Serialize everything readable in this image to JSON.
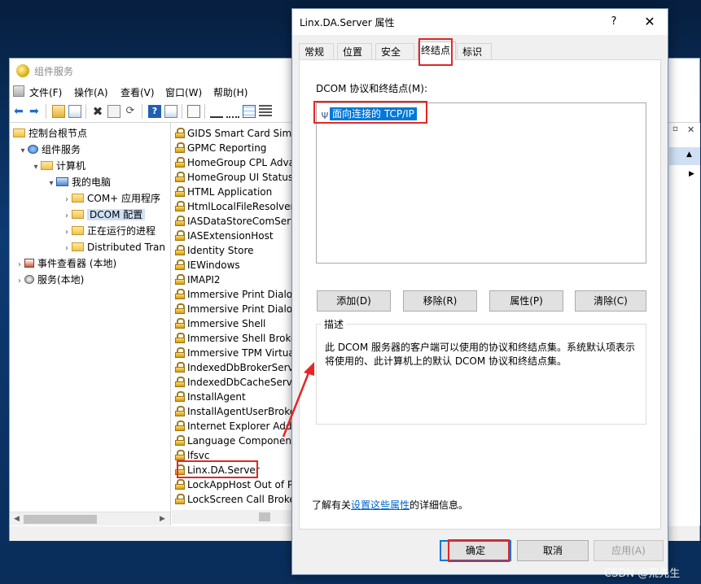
{
  "mmc": {
    "title": "组件服务",
    "menu": [
      "文件(F)",
      "操作(A)",
      "查看(V)",
      "窗口(W)",
      "帮助(H)"
    ],
    "tree": [
      {
        "label": "控制台根节点",
        "expander": ""
      },
      {
        "label": "组件服务",
        "expander": "▾"
      },
      {
        "label": "计算机",
        "expander": "▾"
      },
      {
        "label": "我的电脑",
        "expander": "▾"
      },
      {
        "label": "COM+ 应用程序",
        "expander": "›"
      },
      {
        "label": "DCOM 配置",
        "expander": "›"
      },
      {
        "label": "正在运行的进程",
        "expander": "›"
      },
      {
        "label": "Distributed Tran",
        "expander": "›"
      },
      {
        "label": "事件查看器 (本地)",
        "expander": "›"
      },
      {
        "label": "服务(本地)",
        "expander": "›"
      }
    ],
    "list": [
      "GIDS Smart Card Simu",
      "GPMC Reporting",
      "HomeGroup CPL Adva",
      "HomeGroup UI Status",
      "HTML Application",
      "HtmlLocalFileResolver",
      "IASDataStoreComServ",
      "IASExtensionHost",
      "Identity Store",
      "IEWindows",
      "IMAPI2",
      "Immersive Print Dialog",
      "Immersive Print Dialog",
      "Immersive Shell",
      "Immersive Shell Broke",
      "Immersive TPM Virtua",
      "IndexedDbBrokerServ",
      "IndexedDbCacheServe",
      "InstallAgent",
      "InstallAgentUserBroke",
      "Internet Explorer Add",
      "Language Component",
      "lfsvc",
      "Linx.DA.Server",
      "LockAppHost Out of P",
      "LockScreen Call Broke"
    ]
  },
  "dialog": {
    "title": "Linx.DA.Server 属性",
    "help": "?",
    "close": "✕",
    "tabs": [
      "常规",
      "位置",
      "安全",
      "终结点",
      "标识"
    ],
    "active_tab": "终结点",
    "protocols_label": "DCOM 协议和终结点(M):",
    "protocols": [
      "面向连接的 TCP/IP"
    ],
    "buttons": {
      "add": "添加(D)",
      "remove": "移除(R)",
      "properties": "属性(P)",
      "clear": "清除(C)"
    },
    "description_title": "描述",
    "description": "此 DCOM 服务器的客户端可以使用的协议和终结点集。系统默认项表示将使用的、此计算机上的默认 DCOM 协议和终结点集。",
    "info_prefix": "了解有关",
    "info_link": "设置这些属性",
    "info_suffix": "的详细信息。",
    "ok": "确定",
    "cancel": "取消",
    "apply": "应用(A)"
  },
  "watermark": "CSDN @荒先生",
  "colors": {
    "annotation": "#e32626",
    "selection": "#0078d7",
    "link": "#0066cc"
  }
}
